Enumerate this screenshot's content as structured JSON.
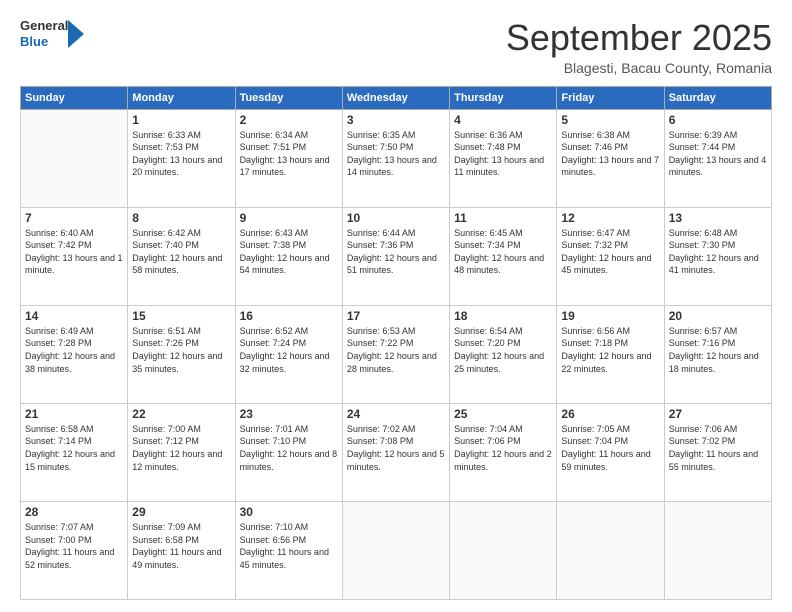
{
  "header": {
    "logo_general": "General",
    "logo_blue": "Blue",
    "month_title": "September 2025",
    "location": "Blagesti, Bacau County, Romania"
  },
  "days_of_week": [
    "Sunday",
    "Monday",
    "Tuesday",
    "Wednesday",
    "Thursday",
    "Friday",
    "Saturday"
  ],
  "weeks": [
    [
      {
        "day": "",
        "empty": true
      },
      {
        "day": "1",
        "sunrise": "Sunrise: 6:33 AM",
        "sunset": "Sunset: 7:53 PM",
        "daylight": "Daylight: 13 hours and 20 minutes."
      },
      {
        "day": "2",
        "sunrise": "Sunrise: 6:34 AM",
        "sunset": "Sunset: 7:51 PM",
        "daylight": "Daylight: 13 hours and 17 minutes."
      },
      {
        "day": "3",
        "sunrise": "Sunrise: 6:35 AM",
        "sunset": "Sunset: 7:50 PM",
        "daylight": "Daylight: 13 hours and 14 minutes."
      },
      {
        "day": "4",
        "sunrise": "Sunrise: 6:36 AM",
        "sunset": "Sunset: 7:48 PM",
        "daylight": "Daylight: 13 hours and 11 minutes."
      },
      {
        "day": "5",
        "sunrise": "Sunrise: 6:38 AM",
        "sunset": "Sunset: 7:46 PM",
        "daylight": "Daylight: 13 hours and 7 minutes."
      },
      {
        "day": "6",
        "sunrise": "Sunrise: 6:39 AM",
        "sunset": "Sunset: 7:44 PM",
        "daylight": "Daylight: 13 hours and 4 minutes."
      }
    ],
    [
      {
        "day": "7",
        "sunrise": "Sunrise: 6:40 AM",
        "sunset": "Sunset: 7:42 PM",
        "daylight": "Daylight: 13 hours and 1 minute."
      },
      {
        "day": "8",
        "sunrise": "Sunrise: 6:42 AM",
        "sunset": "Sunset: 7:40 PM",
        "daylight": "Daylight: 12 hours and 58 minutes."
      },
      {
        "day": "9",
        "sunrise": "Sunrise: 6:43 AM",
        "sunset": "Sunset: 7:38 PM",
        "daylight": "Daylight: 12 hours and 54 minutes."
      },
      {
        "day": "10",
        "sunrise": "Sunrise: 6:44 AM",
        "sunset": "Sunset: 7:36 PM",
        "daylight": "Daylight: 12 hours and 51 minutes."
      },
      {
        "day": "11",
        "sunrise": "Sunrise: 6:45 AM",
        "sunset": "Sunset: 7:34 PM",
        "daylight": "Daylight: 12 hours and 48 minutes."
      },
      {
        "day": "12",
        "sunrise": "Sunrise: 6:47 AM",
        "sunset": "Sunset: 7:32 PM",
        "daylight": "Daylight: 12 hours and 45 minutes."
      },
      {
        "day": "13",
        "sunrise": "Sunrise: 6:48 AM",
        "sunset": "Sunset: 7:30 PM",
        "daylight": "Daylight: 12 hours and 41 minutes."
      }
    ],
    [
      {
        "day": "14",
        "sunrise": "Sunrise: 6:49 AM",
        "sunset": "Sunset: 7:28 PM",
        "daylight": "Daylight: 12 hours and 38 minutes."
      },
      {
        "day": "15",
        "sunrise": "Sunrise: 6:51 AM",
        "sunset": "Sunset: 7:26 PM",
        "daylight": "Daylight: 12 hours and 35 minutes."
      },
      {
        "day": "16",
        "sunrise": "Sunrise: 6:52 AM",
        "sunset": "Sunset: 7:24 PM",
        "daylight": "Daylight: 12 hours and 32 minutes."
      },
      {
        "day": "17",
        "sunrise": "Sunrise: 6:53 AM",
        "sunset": "Sunset: 7:22 PM",
        "daylight": "Daylight: 12 hours and 28 minutes."
      },
      {
        "day": "18",
        "sunrise": "Sunrise: 6:54 AM",
        "sunset": "Sunset: 7:20 PM",
        "daylight": "Daylight: 12 hours and 25 minutes."
      },
      {
        "day": "19",
        "sunrise": "Sunrise: 6:56 AM",
        "sunset": "Sunset: 7:18 PM",
        "daylight": "Daylight: 12 hours and 22 minutes."
      },
      {
        "day": "20",
        "sunrise": "Sunrise: 6:57 AM",
        "sunset": "Sunset: 7:16 PM",
        "daylight": "Daylight: 12 hours and 18 minutes."
      }
    ],
    [
      {
        "day": "21",
        "sunrise": "Sunrise: 6:58 AM",
        "sunset": "Sunset: 7:14 PM",
        "daylight": "Daylight: 12 hours and 15 minutes."
      },
      {
        "day": "22",
        "sunrise": "Sunrise: 7:00 AM",
        "sunset": "Sunset: 7:12 PM",
        "daylight": "Daylight: 12 hours and 12 minutes."
      },
      {
        "day": "23",
        "sunrise": "Sunrise: 7:01 AM",
        "sunset": "Sunset: 7:10 PM",
        "daylight": "Daylight: 12 hours and 8 minutes."
      },
      {
        "day": "24",
        "sunrise": "Sunrise: 7:02 AM",
        "sunset": "Sunset: 7:08 PM",
        "daylight": "Daylight: 12 hours and 5 minutes."
      },
      {
        "day": "25",
        "sunrise": "Sunrise: 7:04 AM",
        "sunset": "Sunset: 7:06 PM",
        "daylight": "Daylight: 12 hours and 2 minutes."
      },
      {
        "day": "26",
        "sunrise": "Sunrise: 7:05 AM",
        "sunset": "Sunset: 7:04 PM",
        "daylight": "Daylight: 11 hours and 59 minutes."
      },
      {
        "day": "27",
        "sunrise": "Sunrise: 7:06 AM",
        "sunset": "Sunset: 7:02 PM",
        "daylight": "Daylight: 11 hours and 55 minutes."
      }
    ],
    [
      {
        "day": "28",
        "sunrise": "Sunrise: 7:07 AM",
        "sunset": "Sunset: 7:00 PM",
        "daylight": "Daylight: 11 hours and 52 minutes."
      },
      {
        "day": "29",
        "sunrise": "Sunrise: 7:09 AM",
        "sunset": "Sunset: 6:58 PM",
        "daylight": "Daylight: 11 hours and 49 minutes."
      },
      {
        "day": "30",
        "sunrise": "Sunrise: 7:10 AM",
        "sunset": "Sunset: 6:56 PM",
        "daylight": "Daylight: 11 hours and 45 minutes."
      },
      {
        "day": "",
        "empty": true
      },
      {
        "day": "",
        "empty": true
      },
      {
        "day": "",
        "empty": true
      },
      {
        "day": "",
        "empty": true
      }
    ]
  ]
}
